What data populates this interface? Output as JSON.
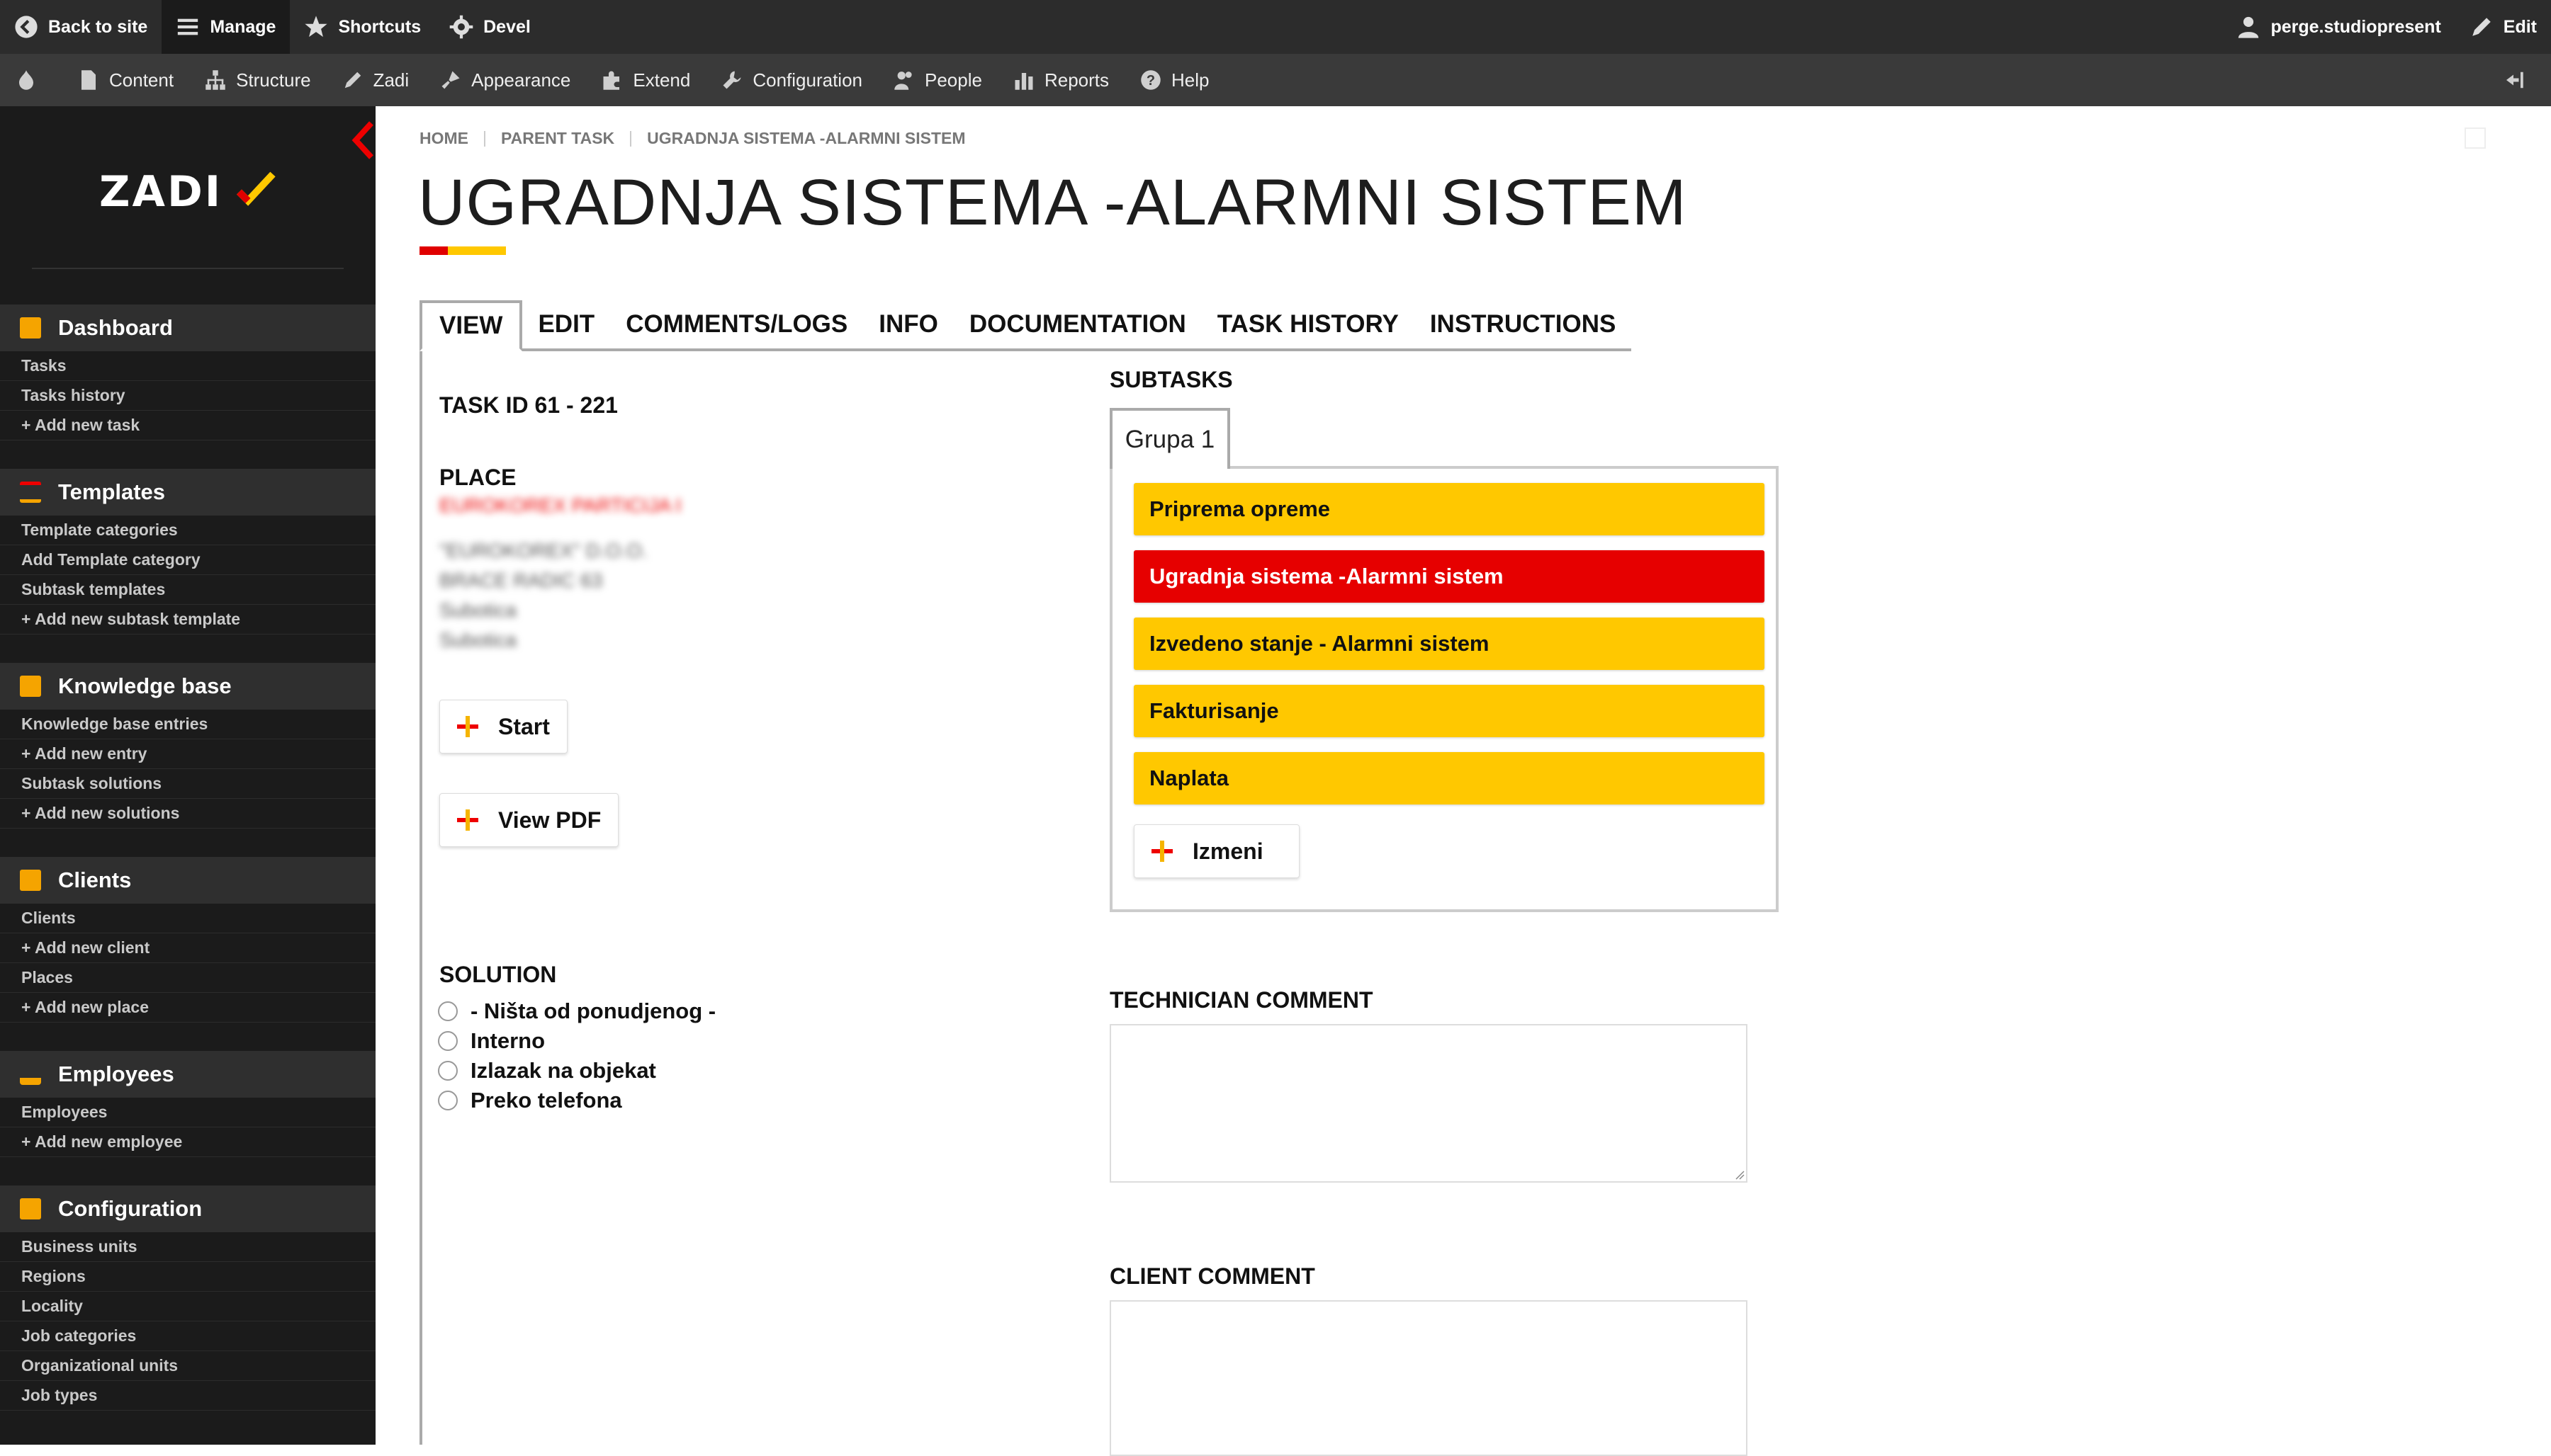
{
  "toolbar": {
    "back_to_site": "Back to site",
    "manage": "Manage",
    "shortcuts": "Shortcuts",
    "devel": "Devel",
    "user": "perge.studiopresent",
    "edit": "Edit"
  },
  "tray": {
    "items": [
      "Content",
      "Structure",
      "Zadi",
      "Appearance",
      "Extend",
      "Configuration",
      "People",
      "Reports",
      "Help"
    ]
  },
  "sidebar": {
    "logo": "ZADI",
    "sections": [
      {
        "title": "Dashboard",
        "links": [
          "Tasks",
          "Tasks history",
          "+ Add new task"
        ]
      },
      {
        "title": "Templates",
        "links": [
          "Template categories",
          "Add Template category",
          "Subtask templates",
          "+ Add new subtask template"
        ]
      },
      {
        "title": "Knowledge base",
        "links": [
          "Knowledge base entries",
          "+ Add new entry",
          "Subtask solutions",
          "+ Add new solutions"
        ]
      },
      {
        "title": "Clients",
        "links": [
          "Clients",
          "+ Add new client",
          "Places",
          "+ Add new place"
        ]
      },
      {
        "title": "Employees",
        "links": [
          "Employees",
          "+ Add new employee"
        ]
      },
      {
        "title": "Configuration",
        "links": [
          "Business units",
          "Regions",
          "Locality",
          "Job categories",
          "Organizational units",
          "Job types"
        ]
      }
    ]
  },
  "breadcrumb": [
    "HOME",
    "PARENT TASK",
    "UGRADNJA SISTEMA -ALARMNI SISTEM"
  ],
  "page": {
    "title": "UGRADNJA SISTEMA -ALARMNI SISTEM"
  },
  "tabs": [
    "VIEW",
    "EDIT",
    "COMMENTS/LOGS",
    "INFO",
    "DOCUMENTATION",
    "TASK HISTORY",
    "INSTRUCTIONS"
  ],
  "task": {
    "id_label": "TASK ID 61 - 221",
    "place_label": "PLACE",
    "place_name": "EUROKOREX PARTICIJA I",
    "place_lines": [
      "\"EUROKOREX\" D.O.O.",
      "BRACE RADIC 63",
      "Subotica",
      "Subotica"
    ],
    "start_button": "Start",
    "view_pdf_button": "View PDF"
  },
  "subtasks": {
    "label": "SUBTASKS",
    "group_tab": "Grupa 1",
    "items": [
      {
        "label": "Priprema opreme",
        "status": "yellow"
      },
      {
        "label": "Ugradnja sistema -Alarmni sistem",
        "status": "red"
      },
      {
        "label": "Izvedeno stanje - Alarmni sistem",
        "status": "yellow"
      },
      {
        "label": "Fakturisanje",
        "status": "yellow"
      },
      {
        "label": "Naplata",
        "status": "yellow"
      }
    ],
    "edit_button": "Izmeni"
  },
  "solution": {
    "label": "SOLUTION",
    "options": [
      "- Ništa od ponudjenog -",
      "Interno",
      "Izlazak na objekat",
      "Preko telefona"
    ]
  },
  "comments": {
    "technician_label": "TECHNICIAN COMMENT",
    "client_label": "CLIENT COMMENT"
  },
  "colors": {
    "accent_red": "#e60000",
    "accent_yellow": "#ffc800",
    "sidebar_bg": "#1b1b1b",
    "toolbar_bg": "#2c2c2c"
  }
}
